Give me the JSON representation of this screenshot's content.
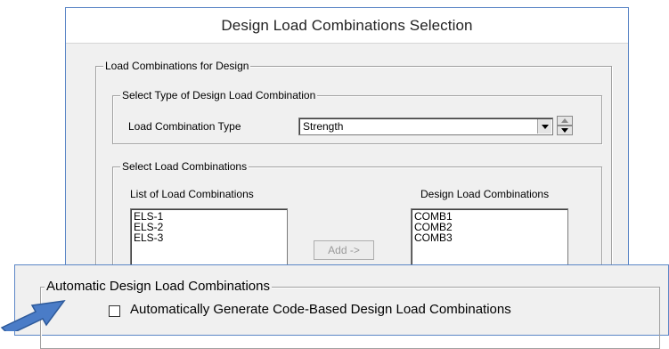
{
  "dialog": {
    "title": "Design Load Combinations Selection",
    "group_main": "Load Combinations for Design",
    "type_group": {
      "legend": "Select Type of Design Load Combination",
      "label": "Load Combination Type",
      "selected": "Strength"
    },
    "select_group": {
      "legend": "Select Load Combinations",
      "list_header": "List of Load Combinations",
      "design_header": "Design Load Combinations",
      "list_items": [
        "ELS-1",
        "ELS-2",
        "ELS-3"
      ],
      "design_items": [
        "COMB1",
        "COMB2",
        "COMB3"
      ],
      "add_button": "Add ->"
    }
  },
  "overlay": {
    "legend": "Automatic Design Load Combinations",
    "checkbox_label": "Automatically Generate Code-Based Design Load Combinations",
    "checkbox_checked": false
  },
  "icons": {
    "dropdown": "chevron-down-icon",
    "spin_up": "spin-up-icon",
    "spin_down": "spin-down-icon",
    "pointer_arrow": "pointer-arrow-icon"
  },
  "colors": {
    "window_border": "#5b86c6",
    "panel_bg": "#f0f0f0",
    "arrow_fill": "#4a7cc7"
  }
}
